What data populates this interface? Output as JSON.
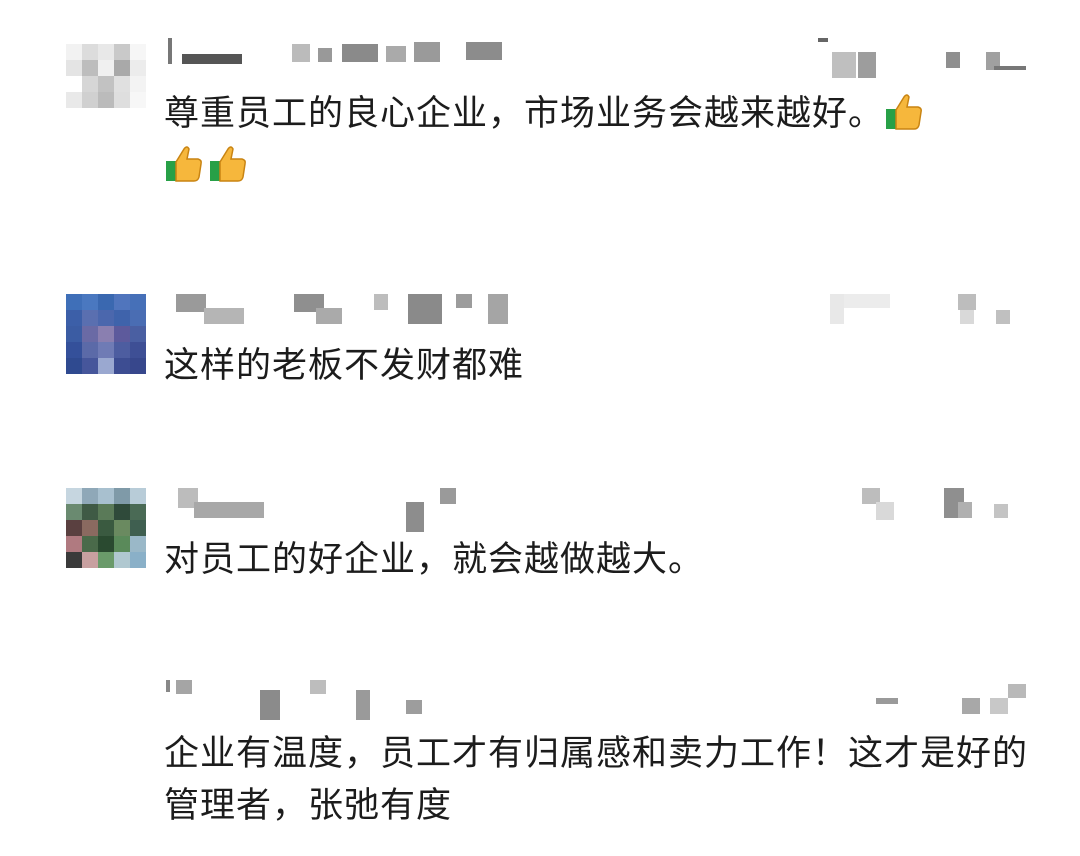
{
  "comments": [
    {
      "avatar_colors": [
        "#f2f2f2",
        "#dcdcdc",
        "#e8e8e8",
        "#c9c9c9",
        "#f6f6f6",
        "#e4e4e4",
        "#bdbdbd",
        "#f0f0f0",
        "#a9a9a9",
        "#ececec",
        "#ffffff",
        "#d6d6d6",
        "#c2c2c2",
        "#e0e0e0",
        "#f3f3f3",
        "#e9e9e9",
        "#d0d0d0",
        "#bbbbbb",
        "#dedede",
        "#f7f7f7",
        "#ffffff",
        "#ffffff",
        "#ffffff",
        "#ffffff",
        "#ffffff"
      ],
      "text": "尊重员工的良心企业，市场业务会越来越好。",
      "emoji": [
        "thumbs-up",
        "thumbs-up",
        "thumbs-up"
      ]
    },
    {
      "avatar_colors": [
        "#3f6fb8",
        "#4a78c0",
        "#3a68b0",
        "#5075bd",
        "#4670b8",
        "#3c5fa8",
        "#5a6fb0",
        "#4b67ad",
        "#3f63ab",
        "#4a6db3",
        "#3b5ca3",
        "#6a6aa5",
        "#8a7fb0",
        "#5d5a9c",
        "#4a5fa2",
        "#34509a",
        "#5b6aa8",
        "#6f7bb5",
        "#4d5da0",
        "#3e4f95",
        "#2f4a90",
        "#46569b",
        "#9aa8d0",
        "#3d4d92",
        "#37478c"
      ],
      "text": "这样的老板不发财都难",
      "emoji": []
    },
    {
      "avatar_colors": [
        "#c6d6e0",
        "#8fa8b8",
        "#a8c0cf",
        "#7f9aa8",
        "#b8ccd8",
        "#6a8a70",
        "#3f5a45",
        "#5a7a58",
        "#2f4a3a",
        "#4a6a55",
        "#5a4040",
        "#8a6a60",
        "#3a5a40",
        "#6a8a60",
        "#3f5f50",
        "#b07a80",
        "#4a6a4a",
        "#2a4a30",
        "#5a8a5a",
        "#9ab8c8",
        "#3a3a3a",
        "#c8a0a0",
        "#6a9a6a",
        "#b0c8d0",
        "#8ab0c8"
      ],
      "text": "对员工的好企业，就会越做越大。",
      "emoji": []
    },
    {
      "avatar_colors": [],
      "text": "企业有温度，员工才有归属感和卖力工作！这才是好的管理者，张弛有度",
      "emoji": []
    }
  ]
}
